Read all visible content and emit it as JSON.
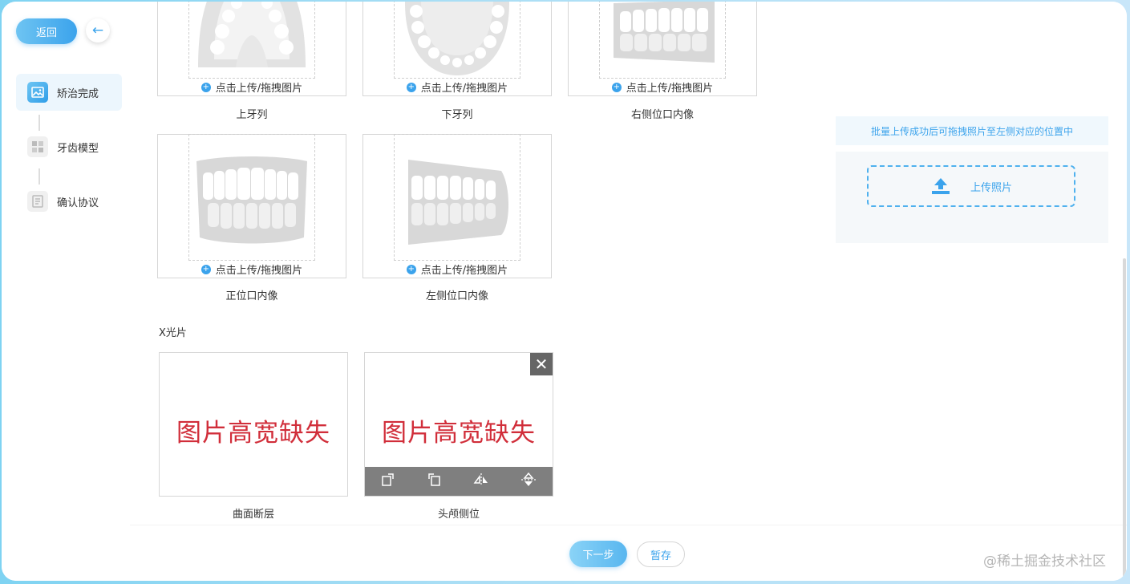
{
  "sidebar": {
    "back_label": "返回",
    "steps": [
      {
        "label": "矫治完成",
        "icon": "image-icon",
        "active": true
      },
      {
        "label": "牙齿模型",
        "icon": "grid-icon",
        "active": false
      },
      {
        "label": "确认协议",
        "icon": "document-icon",
        "active": false
      }
    ]
  },
  "photos": {
    "upload_hint": "点击上传/拖拽图片",
    "row1": [
      "上牙列",
      "下牙列",
      "右侧位口内像"
    ],
    "row2": [
      "正位口内像",
      "左侧位口内像"
    ]
  },
  "xray": {
    "section_title": "X光片",
    "missing_text": "图片高宽缺失",
    "items": [
      "曲面断层",
      "头颅侧位"
    ],
    "close_symbol": "✕"
  },
  "batch": {
    "tip": "批量上传成功后可拖拽照片至左侧对应的位置中",
    "upload_label": "上传照片"
  },
  "footer": {
    "next_label": "下一步",
    "save_label": "暂存"
  },
  "watermark": "@稀土掘金技术社区",
  "colors": {
    "accent": "#3ba3ec",
    "error_text": "#d12e3a"
  }
}
